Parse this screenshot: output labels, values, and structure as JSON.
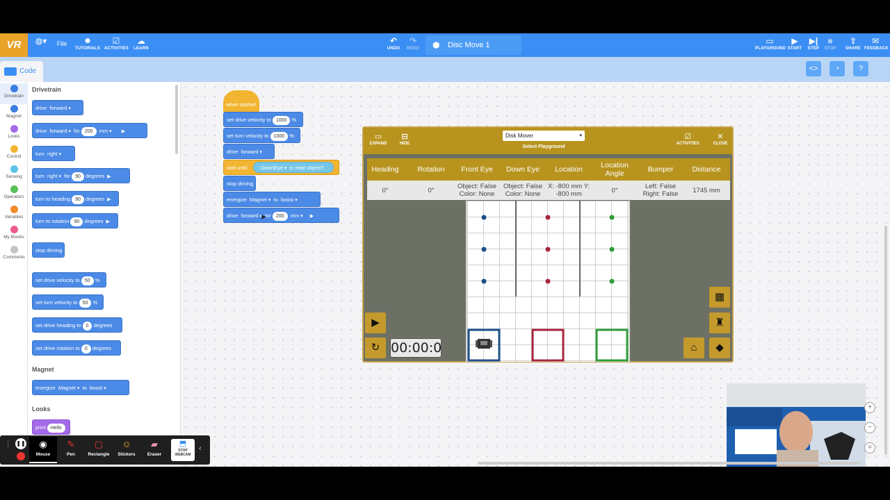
{
  "app": {
    "logo": "VR",
    "menu_file": "File",
    "toolbar": {
      "tutorials": "TUTORIALS",
      "activities": "ACTIVITIES",
      "learn": "LEARN",
      "undo": "UNDO",
      "redo": "REDO",
      "project_name": "Disc Move 1",
      "playground": "PLAYGROUND",
      "start": "START",
      "step": "STEP",
      "stop": "STOP",
      "share": "SHARE",
      "feedback": "FEEDBACK"
    },
    "code_tab": "Code"
  },
  "categories": [
    {
      "label": "Drivetrain",
      "color": "#3b7fe0",
      "selected": true
    },
    {
      "label": "Magnet",
      "color": "#3b7fe0"
    },
    {
      "label": "Looks",
      "color": "#a46be8"
    },
    {
      "label": "Control",
      "color": "#f2b531"
    },
    {
      "label": "Sensing",
      "color": "#5cc3e6"
    },
    {
      "label": "Operators",
      "color": "#59c059"
    },
    {
      "label": "Variables",
      "color": "#f08c2e"
    },
    {
      "label": "My Blocks",
      "color": "#ec5b8a"
    },
    {
      "label": "Comments",
      "color": "#c4c4c4"
    }
  ],
  "palette": {
    "drivetrain_head": "Drivetrain",
    "magnet_head": "Magnet",
    "looks_head": "Looks",
    "blocks": {
      "drive": "drive",
      "forward": "forward",
      "for": "for",
      "mm": "mm",
      "v200": "200",
      "turn": "turn",
      "right": "right",
      "v90": "90",
      "degrees": "degrees",
      "turn_to_heading": "turn to heading",
      "turn_to_rotation": "turn to rotation",
      "stop_driving": "stop driving",
      "set_drive_velocity_to": "set drive velocity to",
      "set_turn_velocity_to": "set turn velocity to",
      "v50": "50",
      "percent": "%",
      "set_drive_heading_to": "set drive heading to",
      "set_drive_rotation_to": "set drive rotation to",
      "v0": "0",
      "energize": "energize",
      "magnet": "Magnet",
      "to": "to",
      "boost": "boost",
      "print": "print",
      "hello": "Hello"
    }
  },
  "script": {
    "when_started": "when started",
    "set_drive_velocity_to": "set drive velocity to",
    "set_turn_velocity_to": "set turn velocity to",
    "v1000": "1000",
    "percent": "%",
    "drive": "drive",
    "forward": "forward",
    "wait_until": "wait until",
    "downeye": "DownEye",
    "is_near_object": "is near object?",
    "stop_driving": "stop driving",
    "energize": "energize",
    "magnet": "Magnet",
    "to": "to",
    "boost": "boost",
    "for": "for",
    "v200": "200",
    "mm": "mm"
  },
  "playground": {
    "expand": "EXPAND",
    "hide": "HIDE",
    "selected": "Disk Mover",
    "select_label": "Select Playground",
    "activities": "ACTIVITIES",
    "close": "CLOSE",
    "headers": [
      "Heading",
      "Rotation",
      "Front Eye",
      "Down Eye",
      "Location",
      "Location Angle",
      "Bumper",
      "Distance"
    ],
    "values": [
      "0°",
      "0°",
      "Object: False Color: None",
      "Object: False Color: None",
      "X: -800 mm Y: -800 mm",
      "0°",
      "Left: False Right: False",
      "1745 mm"
    ],
    "timer": "00:00:0",
    "disk_colors": [
      "#1d4f8a",
      "#a8243d",
      "#2e9c3a"
    ]
  },
  "drawbar": {
    "mouse": "Mouse",
    "pen": "Pen",
    "rectangle": "Rectangle",
    "stickers": "Stickers",
    "eraser": "Eraser",
    "stop_webcam_1": "STOP",
    "stop_webcam_2": "WEBCAM"
  }
}
